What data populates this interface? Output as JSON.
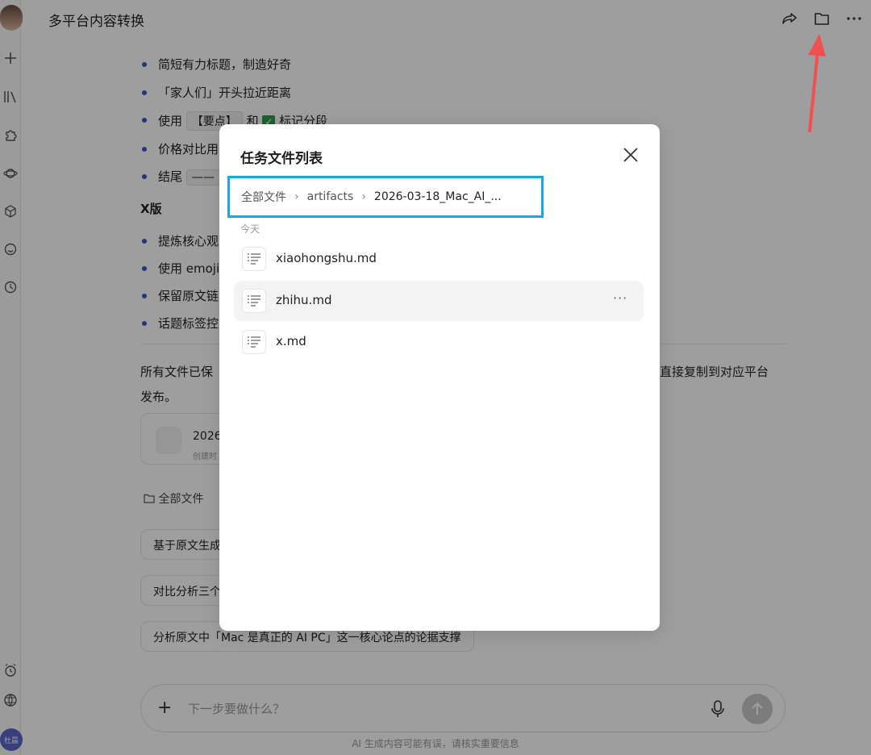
{
  "window": {
    "title": "多平台内容转换"
  },
  "rail": {
    "bottom_avatar": "杜晨"
  },
  "background": {
    "bullets_xiaohongshu": [
      "简短有力标题，制造好奇",
      "「家人们」开头拉近距离",
      "价格对比用",
      "结尾"
    ],
    "bullet_use": {
      "prefix": "使用",
      "chip": "【要点】",
      "mid": "和",
      "suffix": "标记分段"
    },
    "section_x": "X版",
    "bullets_x": [
      "提炼核心观",
      "使用 emoji",
      "保留原文链",
      "话题标签控"
    ],
    "saved_para_line1": "所有文件已保",
    "saved_para_line1_end": "直接复制到对应平台",
    "saved_para_line2": "发布。",
    "file_card": {
      "name": "2026",
      "meta": "创建时"
    },
    "all_files_link": "全部文件",
    "suggestions": [
      "基于原文生成",
      "对比分析三个",
      "分析原文中「Mac 是真正的 AI PC」这一核心论点的论据支撑"
    ],
    "input_placeholder": "下一步要做什么？",
    "disclaimer": "AI 生成内容可能有误，请核实重要信息"
  },
  "modal": {
    "title": "任务文件列表",
    "breadcrumb": [
      "全部文件",
      "artifacts",
      "2026-03-18_Mac_AI_..."
    ],
    "group_label": "今天",
    "files": [
      {
        "name": "xiaohongshu.md",
        "highlighted": false
      },
      {
        "name": "zhihu.md",
        "highlighted": true
      },
      {
        "name": "x.md",
        "highlighted": false
      }
    ],
    "more_label": "···"
  },
  "colors": {
    "breadcrumb_highlight": "#18a8e6",
    "annotation_arrow": "#f0514f",
    "bullet_dot": "#3b56c9"
  }
}
